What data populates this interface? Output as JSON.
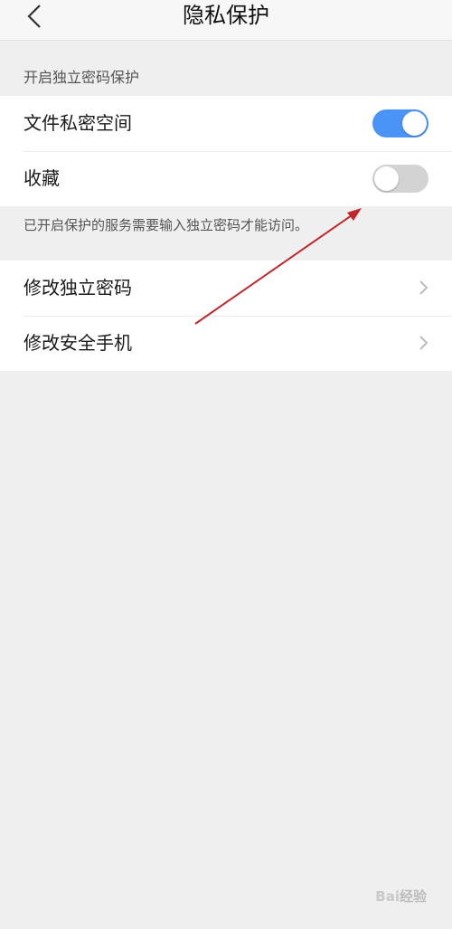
{
  "header": {
    "title": "隐私保护",
    "back_icon": "chevron-left-icon"
  },
  "privacy_section": {
    "caption": "开启独立密码保护",
    "items": [
      {
        "label": "文件私密空间",
        "toggle_on": true
      },
      {
        "label": "收藏",
        "toggle_on": false
      }
    ],
    "note": "已开启保护的服务需要输入独立密码才能访问。"
  },
  "settings_section": {
    "items": [
      {
        "label": "修改独立密码",
        "icon": "chevron-right-icon"
      },
      {
        "label": "修改安全手机",
        "icon": "chevron-right-icon"
      }
    ]
  },
  "colors": {
    "toggle_on": "#4a94f7",
    "toggle_off": "#d3d3d3",
    "annotation_arrow": "#c0272d"
  },
  "watermark": {
    "text": "Bai经验"
  }
}
